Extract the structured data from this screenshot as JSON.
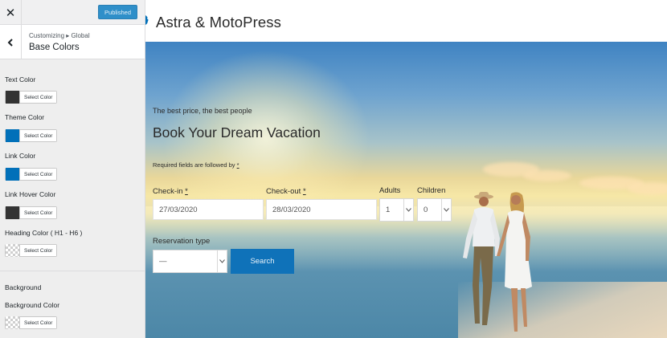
{
  "topbar": {
    "close_glyph": "✕",
    "publish_label": "Published"
  },
  "section": {
    "breadcrumb": "Customizing ▸ Global",
    "title": "Base Colors"
  },
  "controls": [
    {
      "label": "Text Color",
      "button": "Select Color",
      "color": "#333333"
    },
    {
      "label": "Theme Color",
      "button": "Select Color",
      "color": "#0170b9"
    },
    {
      "label": "Link Color",
      "button": "Select Color",
      "color": "#0170b9"
    },
    {
      "label": "Link Hover Color",
      "button": "Select Color",
      "color": "#333333"
    },
    {
      "label": "Heading Color ( H1 - H6 )",
      "button": "Select Color",
      "color": "transparent"
    }
  ],
  "background": {
    "heading": "Background",
    "label": "Background Color",
    "button": "Select Color",
    "color": "transparent"
  },
  "site": {
    "title": "Astra & MotoPress"
  },
  "hero": {
    "tagline": "The best price, the best people",
    "title": "Book Your Dream Vacation",
    "required_note": "Required fields are followed by ",
    "required_star": "*"
  },
  "form": {
    "checkin": {
      "label": "Check-in ",
      "star": "*",
      "value": "27/03/2020"
    },
    "checkout": {
      "label": "Check-out ",
      "star": "*",
      "value": "28/03/2020"
    },
    "adults": {
      "label": "Adults",
      "value": "1"
    },
    "children": {
      "label": "Children",
      "value": "0"
    },
    "reservation": {
      "label": "Reservation type",
      "value": "—"
    },
    "search_label": "Search"
  },
  "colors": {
    "accent": "#0170b9",
    "publish": "#2f8fc9"
  }
}
